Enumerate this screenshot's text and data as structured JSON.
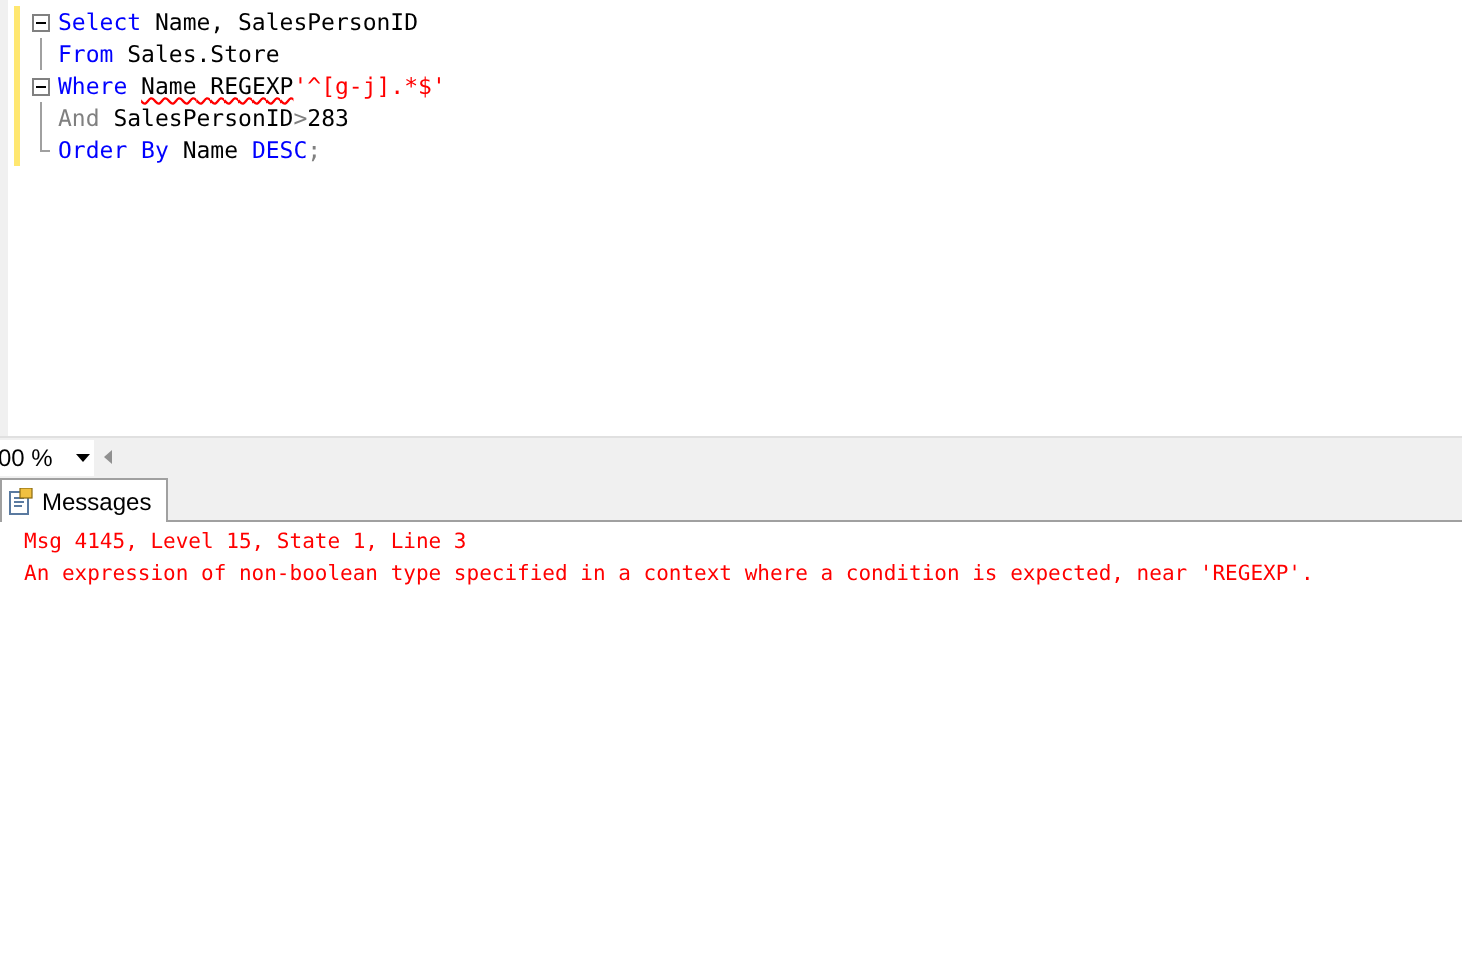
{
  "editor": {
    "lines": [
      {
        "kind": "collapse",
        "tokens": [
          {
            "kind": "keyword",
            "text": "Select"
          },
          {
            "kind": "plain",
            "text": " Name, SalesPersonID"
          }
        ]
      },
      {
        "kind": "line",
        "tokens": [
          {
            "kind": "keyword",
            "text": "From"
          },
          {
            "kind": "plain",
            "text": " Sales.Store"
          }
        ]
      },
      {
        "kind": "collapse",
        "tokens": [
          {
            "kind": "keyword",
            "text": "Where "
          },
          {
            "kind": "error",
            "text": "Name"
          },
          {
            "kind": "error",
            "text": " REGEXP"
          },
          {
            "kind": "string",
            "text": "'^[g-j].*$'"
          }
        ]
      },
      {
        "kind": "line",
        "tokens": [
          {
            "kind": "operator",
            "text": "And"
          },
          {
            "kind": "plain",
            "text": " SalesPersonID"
          },
          {
            "kind": "operator",
            "text": ">"
          },
          {
            "kind": "plain",
            "text": "283"
          }
        ]
      },
      {
        "kind": "end",
        "tokens": [
          {
            "kind": "keyword",
            "text": "Order By"
          },
          {
            "kind": "plain",
            "text": " Name "
          },
          {
            "kind": "keyword",
            "text": "DESC"
          },
          {
            "kind": "operator",
            "text": ";"
          }
        ]
      }
    ]
  },
  "zoom": {
    "value": "00 %"
  },
  "tabs": [
    {
      "label": "Messages",
      "selected": true
    }
  ],
  "messages": [
    "Msg 4145, Level 15, State 1, Line 3",
    "An expression of non-boolean type specified in a context where a condition is expected, near 'REGEXP'."
  ]
}
